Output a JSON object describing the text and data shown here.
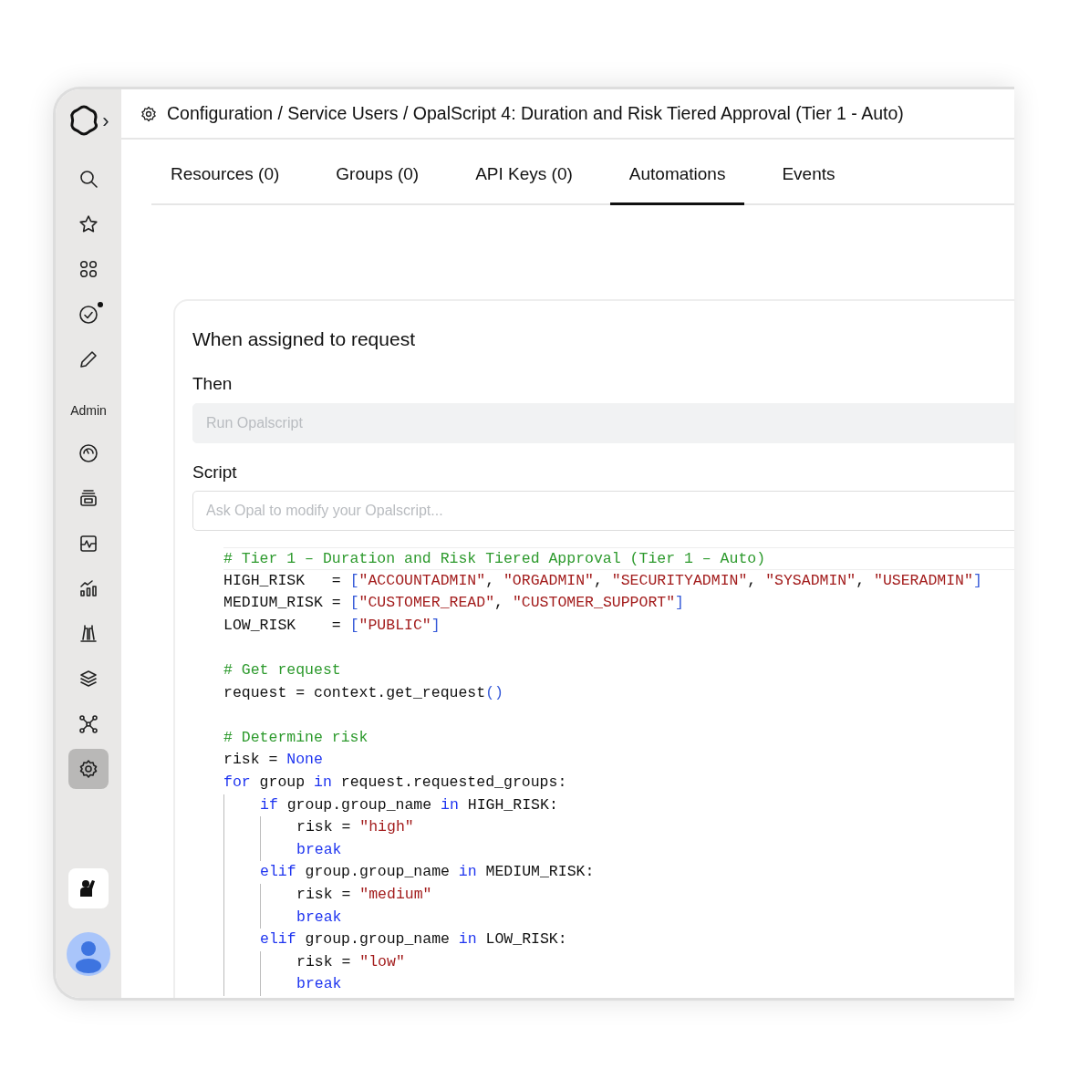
{
  "sidebar": {
    "logo": {
      "expand_caret": "›"
    },
    "main_items": [
      {
        "selected": false,
        "has_dot": false
      },
      {
        "selected": false,
        "has_dot": false
      },
      {
        "selected": false,
        "has_dot": false
      },
      {
        "selected": false,
        "has_dot": true
      },
      {
        "selected": false,
        "has_dot": false
      }
    ],
    "section_label": "Admin",
    "admin_items": [
      {
        "selected": false
      },
      {
        "selected": false
      },
      {
        "selected": false
      },
      {
        "selected": false
      },
      {
        "selected": false
      },
      {
        "selected": false
      },
      {
        "selected": false
      },
      {
        "selected": true
      }
    ]
  },
  "breadcrumb": "Configuration / Service Users / OpalScript 4: Duration and Risk Tiered Approval (Tier 1 - Auto)",
  "tabs": [
    {
      "label": "Resources (0)",
      "selected": false
    },
    {
      "label": "Groups (0)",
      "selected": false
    },
    {
      "label": "API Keys (0)",
      "selected": false
    },
    {
      "label": "Automations",
      "selected": true
    },
    {
      "label": "Events",
      "selected": false
    }
  ],
  "automation": {
    "title": "When assigned to request",
    "then_label": "Then",
    "action_field": {
      "placeholder": "Run Opalscript",
      "disabled": true
    },
    "script_label": "Script",
    "ask_field": {
      "placeholder": "Ask Opal to modify your Opalscript..."
    },
    "code_blocks": [
      {
        "lines": [
          {
            "current": true,
            "tokens": [
              {
                "kind": "comment",
                "text": "# Tier 1 – Duration and Risk Tiered Approval (Tier 1 – Auto)"
              }
            ]
          },
          {
            "current": false,
            "tokens": [
              {
                "kind": "plain",
                "text": "HIGH_RISK   = "
              },
              {
                "kind": "bracket",
                "text": "["
              },
              {
                "kind": "string",
                "text": "\"ACCOUNTADMIN\""
              },
              {
                "kind": "plain",
                "text": ", "
              },
              {
                "kind": "string",
                "text": "\"ORGADMIN\""
              },
              {
                "kind": "plain",
                "text": ", "
              },
              {
                "kind": "string",
                "text": "\"SECURITYADMIN\""
              },
              {
                "kind": "plain",
                "text": ", "
              },
              {
                "kind": "string",
                "text": "\"SYSADMIN\""
              },
              {
                "kind": "plain",
                "text": ", "
              },
              {
                "kind": "string",
                "text": "\"USERADMIN\""
              },
              {
                "kind": "bracket",
                "text": "]"
              }
            ]
          },
          {
            "current": false,
            "tokens": [
              {
                "kind": "plain",
                "text": "MEDIUM_RISK = "
              },
              {
                "kind": "bracket",
                "text": "["
              },
              {
                "kind": "string",
                "text": "\"CUSTOMER_READ\""
              },
              {
                "kind": "plain",
                "text": ", "
              },
              {
                "kind": "string",
                "text": "\"CUSTOMER_SUPPORT\""
              },
              {
                "kind": "bracket",
                "text": "]"
              }
            ]
          },
          {
            "current": false,
            "tokens": [
              {
                "kind": "plain",
                "text": "LOW_RISK    = "
              },
              {
                "kind": "bracket",
                "text": "["
              },
              {
                "kind": "string",
                "text": "\"PUBLIC\""
              },
              {
                "kind": "bracket",
                "text": "]"
              }
            ]
          }
        ]
      },
      {
        "lines": [
          {
            "current": false,
            "tokens": [
              {
                "kind": "comment",
                "text": "# Get request"
              }
            ]
          },
          {
            "current": false,
            "tokens": [
              {
                "kind": "plain",
                "text": "request = context.get_request"
              },
              {
                "kind": "bracket",
                "text": "()"
              }
            ]
          }
        ]
      },
      {
        "lines": [
          {
            "current": false,
            "tokens": [
              {
                "kind": "comment",
                "text": "# Determine risk"
              }
            ]
          },
          {
            "current": false,
            "tokens": [
              {
                "kind": "plain",
                "text": "risk = "
              },
              {
                "kind": "keyword",
                "text": "None"
              }
            ]
          },
          {
            "current": false,
            "tokens": [
              {
                "kind": "keyword",
                "text": "for"
              },
              {
                "kind": "plain",
                "text": " group "
              },
              {
                "kind": "keyword",
                "text": "in"
              },
              {
                "kind": "plain",
                "text": " request.requested_groups:"
              }
            ],
            "children": [
              {
                "current": false,
                "tokens": [
                  {
                    "kind": "keyword",
                    "text": "if"
                  },
                  {
                    "kind": "plain",
                    "text": " group.group_name "
                  },
                  {
                    "kind": "keyword",
                    "text": "in"
                  },
                  {
                    "kind": "plain",
                    "text": " HIGH_RISK:"
                  }
                ],
                "children": [
                  {
                    "current": false,
                    "tokens": [
                      {
                        "kind": "plain",
                        "text": "risk = "
                      },
                      {
                        "kind": "string",
                        "text": "\"high\""
                      }
                    ]
                  },
                  {
                    "current": false,
                    "tokens": [
                      {
                        "kind": "keyword",
                        "text": "break"
                      }
                    ]
                  }
                ]
              },
              {
                "current": false,
                "tokens": [
                  {
                    "kind": "keyword",
                    "text": "elif"
                  },
                  {
                    "kind": "plain",
                    "text": " group.group_name "
                  },
                  {
                    "kind": "keyword",
                    "text": "in"
                  },
                  {
                    "kind": "plain",
                    "text": " MEDIUM_RISK:"
                  }
                ],
                "children": [
                  {
                    "current": false,
                    "tokens": [
                      {
                        "kind": "plain",
                        "text": "risk = "
                      },
                      {
                        "kind": "string",
                        "text": "\"medium\""
                      }
                    ]
                  },
                  {
                    "current": false,
                    "tokens": [
                      {
                        "kind": "keyword",
                        "text": "break"
                      }
                    ]
                  }
                ]
              },
              {
                "current": false,
                "tokens": [
                  {
                    "kind": "keyword",
                    "text": "elif"
                  },
                  {
                    "kind": "plain",
                    "text": " group.group_name "
                  },
                  {
                    "kind": "keyword",
                    "text": "in"
                  },
                  {
                    "kind": "plain",
                    "text": " LOW_RISK:"
                  }
                ],
                "children": [
                  {
                    "current": false,
                    "tokens": [
                      {
                        "kind": "plain",
                        "text": "risk = "
                      },
                      {
                        "kind": "string",
                        "text": "\"low\""
                      }
                    ]
                  },
                  {
                    "current": false,
                    "tokens": [
                      {
                        "kind": "keyword",
                        "text": "break"
                      }
                    ]
                  }
                ]
              }
            ]
          }
        ]
      }
    ]
  }
}
